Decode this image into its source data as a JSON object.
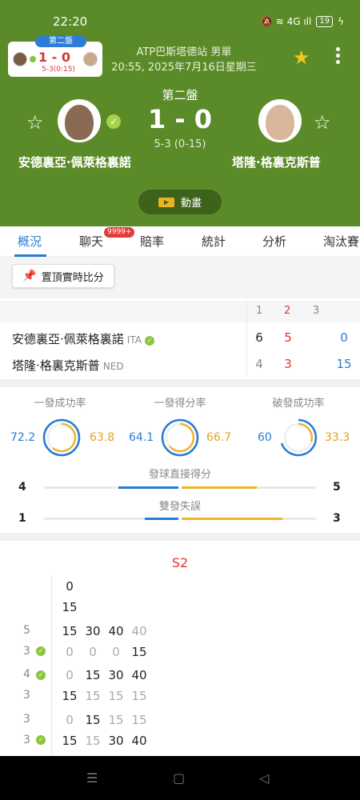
{
  "status_bar": {
    "time": "22:20",
    "icons": "🔕 ≋ 4G ıll",
    "battery": "19"
  },
  "mini_card": {
    "set_tag": "第二盤",
    "score": "1 - 0",
    "sub": "5-3(0:15)"
  },
  "event": {
    "title": "ATP巴斯塔德站 男單",
    "datetime": "20:55, 2025年7月16日星期三"
  },
  "match": {
    "set_label": "第二盤",
    "score": "1 - 0",
    "game_score": "5-3 (0-15)",
    "player1": {
      "name": "安德裏亞·佩萊格裏諾",
      "country": "ITA"
    },
    "player2": {
      "name": "塔隆·格裏克斯普",
      "country": "NED"
    }
  },
  "animation_button": "動畫",
  "tabs": [
    {
      "label": "概況",
      "active": true
    },
    {
      "label": "聊天",
      "badge": "9999+"
    },
    {
      "label": "賠率"
    },
    {
      "label": "統計"
    },
    {
      "label": "分析"
    },
    {
      "label": "淘汰賽"
    }
  ],
  "pin_button": "置頂實時比分",
  "scoreboard": {
    "columns": [
      "1",
      "2",
      "3"
    ],
    "rows": [
      {
        "name": "安德裏亞·佩萊格裏諾",
        "country": "ITA",
        "sets": [
          "6",
          "5"
        ],
        "points": "0"
      },
      {
        "name": "塔隆·格裏克斯普",
        "country": "NED",
        "sets": [
          "4",
          "3"
        ],
        "points": "15"
      }
    ]
  },
  "stats": {
    "rings": [
      {
        "title": "一發成功率",
        "left": "72.2",
        "right": "63.8"
      },
      {
        "title": "一發得分率",
        "left": "64.1",
        "right": "66.7"
      },
      {
        "title": "破發成功率",
        "left": "60",
        "right": "33.3"
      }
    ],
    "bars": [
      {
        "title": "發球直接得分",
        "left": "4",
        "right": "5"
      },
      {
        "title": "雙發失誤",
        "left": "1",
        "right": "3"
      }
    ]
  },
  "pbp": {
    "set_label": "S2",
    "top_points": [
      "0",
      "15"
    ],
    "games": [
      {
        "g1": "5",
        "g2": "3",
        "row1": [
          "15",
          "30",
          "40",
          "40"
        ],
        "row2": [
          "0",
          "0",
          "0",
          "15"
        ]
      },
      {
        "g1": "4",
        "g2": "3",
        "row1": [
          "0",
          "15",
          "30",
          "40"
        ],
        "row2": [
          "15",
          "15",
          "15",
          "15"
        ]
      },
      {
        "g1": "3",
        "g2": "3",
        "row1": [
          "0",
          "15",
          "15",
          "15"
        ],
        "row2": [
          "15",
          "15",
          "30",
          "40"
        ]
      }
    ]
  },
  "colors": {
    "header_green": "#5b8b28",
    "accent_blue": "#2a7bd4",
    "accent_orange": "#f0b32a",
    "alert_red": "#e03434"
  }
}
